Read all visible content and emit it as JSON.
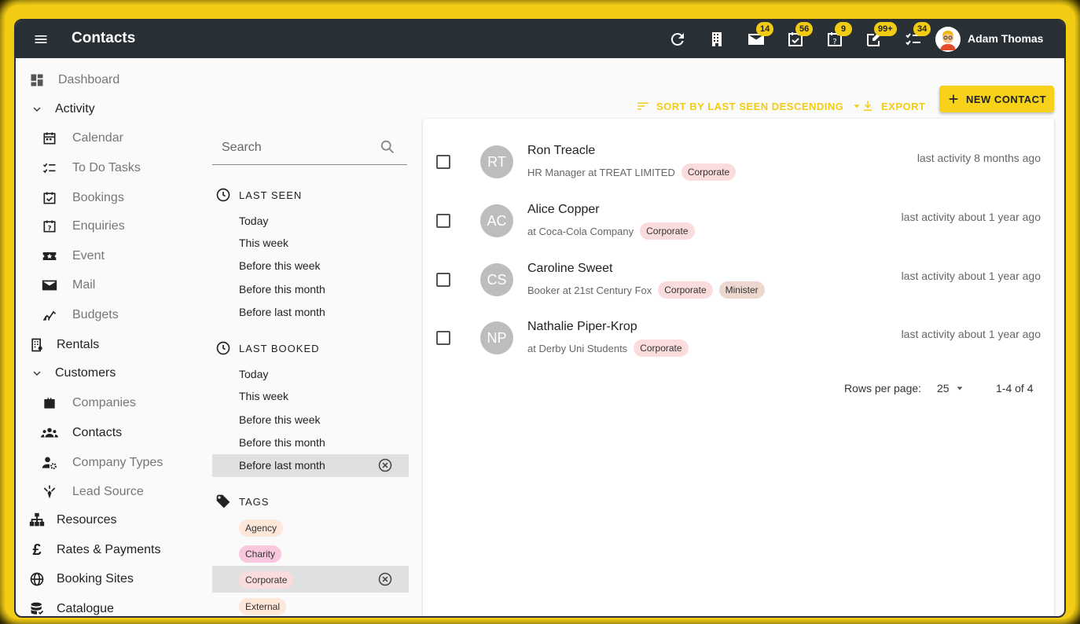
{
  "header": {
    "title": "Contacts",
    "user_name": "Adam Thomas",
    "badges": {
      "mail": "14",
      "tasks": "56",
      "enquiries": "9",
      "notes": "99+",
      "todo": "34"
    }
  },
  "sidebar": {
    "items": [
      {
        "label": "Dashboard"
      },
      {
        "label": "Activity"
      },
      {
        "label": "Calendar"
      },
      {
        "label": "To Do Tasks"
      },
      {
        "label": "Bookings"
      },
      {
        "label": "Enquiries"
      },
      {
        "label": "Event"
      },
      {
        "label": "Mail"
      },
      {
        "label": "Budgets"
      },
      {
        "label": "Rentals"
      },
      {
        "label": "Customers"
      },
      {
        "label": "Companies"
      },
      {
        "label": "Contacts"
      },
      {
        "label": "Company Types"
      },
      {
        "label": "Lead Source"
      },
      {
        "label": "Resources"
      },
      {
        "label": "Rates & Payments"
      },
      {
        "label": "Booking Sites"
      },
      {
        "label": "Catalogue"
      }
    ]
  },
  "filters": {
    "search_placeholder": "Search",
    "last_seen": {
      "header": "LAST SEEN",
      "options": [
        "Today",
        "This week",
        "Before this week",
        "Before this month",
        "Before last month"
      ]
    },
    "last_booked": {
      "header": "LAST BOOKED",
      "options": [
        "Today",
        "This week",
        "Before this week",
        "Before this month",
        "Before last month"
      ],
      "selected": "Before last month"
    },
    "tags": {
      "header": "TAGS",
      "options": [
        "Agency",
        "Charity",
        "Corporate",
        "External"
      ],
      "selected": "Corporate"
    }
  },
  "toolbar": {
    "sort_label": "SORT BY LAST SEEN DESCENDING",
    "export_label": "EXPORT",
    "new_label": "NEW CONTACT"
  },
  "contacts": [
    {
      "initials": "RT",
      "name": "Ron Treacle",
      "subtitle": "HR Manager at TREAT LIMITED",
      "tags": [
        "Corporate"
      ],
      "activity": "last activity 8 months ago"
    },
    {
      "initials": "AC",
      "name": "Alice Copper",
      "subtitle": "at Coca-Cola Company",
      "tags": [
        "Corporate"
      ],
      "activity": "last activity about 1 year ago"
    },
    {
      "initials": "CS",
      "name": "Caroline Sweet",
      "subtitle": "Booker at 21st Century Fox",
      "tags": [
        "Corporate",
        "Minister"
      ],
      "activity": "last activity about 1 year ago"
    },
    {
      "initials": "NP",
      "name": "Nathalie Piper-Krop",
      "subtitle": "at Derby Uni Students",
      "tags": [
        "Corporate"
      ],
      "activity": "last activity about 1 year ago"
    }
  ],
  "pagination": {
    "rows_label": "Rows per page:",
    "rows_value": "25",
    "range": "1-4 of 4"
  },
  "colors": {
    "accent": "#f2cc14",
    "appbar": "#283035",
    "tag_agency": "#fde7d9",
    "tag_charity": "#f8c7de",
    "tag_corporate": "#fbdcdc",
    "tag_external": "#fde7d9",
    "tag_minister": "#ecd8cf"
  }
}
